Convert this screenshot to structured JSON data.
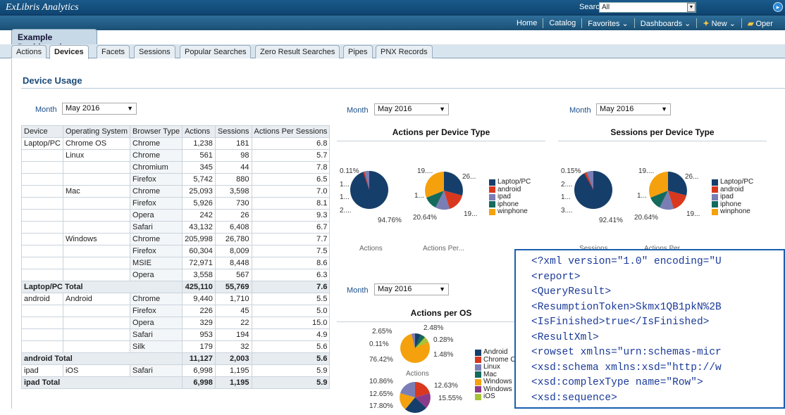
{
  "app": {
    "logo": "ExLibris Analytics",
    "search_label": "Search",
    "search_value": "All",
    "go": "▸"
  },
  "nav": {
    "dashboard_tab": "Example Dashboard",
    "links": [
      "Home",
      "Catalog",
      "Favorites ⌄",
      "Dashboards ⌄",
      "New ⌄",
      "Oper"
    ]
  },
  "tabs": [
    "Actions",
    "Devices",
    "Facets",
    "Sessions",
    "Popular Searches",
    "Zero Result Searches",
    "Pipes",
    "PNX Records"
  ],
  "section_title": "Device Usage",
  "month_label": "Month",
  "month_value": "May 2016",
  "table": {
    "headers": [
      "Device",
      "Operating System",
      "Browser Type",
      "Actions",
      "Sessions",
      "Actions Per Sessions"
    ],
    "rows": [
      [
        "Laptop/PC",
        "Chrome OS",
        "Chrome",
        "1,238",
        "181",
        "6.8"
      ],
      [
        "",
        "Linux",
        "Chrome",
        "561",
        "98",
        "5.7"
      ],
      [
        "",
        "",
        "Chromium",
        "345",
        "44",
        "7.8"
      ],
      [
        "",
        "",
        "Firefox",
        "5,742",
        "880",
        "6.5"
      ],
      [
        "",
        "Mac",
        "Chrome",
        "25,093",
        "3,598",
        "7.0"
      ],
      [
        "",
        "",
        "Firefox",
        "5,926",
        "730",
        "8.1"
      ],
      [
        "",
        "",
        "Opera",
        "242",
        "26",
        "9.3"
      ],
      [
        "",
        "",
        "Safari",
        "43,132",
        "6,408",
        "6.7"
      ],
      [
        "",
        "Windows",
        "Chrome",
        "205,998",
        "26,780",
        "7.7"
      ],
      [
        "",
        "",
        "Firefox",
        "60,304",
        "8,009",
        "7.5"
      ],
      [
        "",
        "",
        "MSIE",
        "72,971",
        "8,448",
        "8.6"
      ],
      [
        "",
        "",
        "Opera",
        "3,558",
        "567",
        "6.3"
      ],
      [
        "Laptop/PC Total",
        "",
        "",
        "425,110",
        "55,769",
        "7.6"
      ],
      [
        "android",
        "Android",
        "Chrome",
        "9,440",
        "1,710",
        "5.5"
      ],
      [
        "",
        "",
        "Firefox",
        "226",
        "45",
        "5.0"
      ],
      [
        "",
        "",
        "Opera",
        "329",
        "22",
        "15.0"
      ],
      [
        "",
        "",
        "Safari",
        "953",
        "194",
        "4.9"
      ],
      [
        "",
        "",
        "Silk",
        "179",
        "32",
        "5.6"
      ],
      [
        "android Total",
        "",
        "",
        "11,127",
        "2,003",
        "5.6"
      ],
      [
        "ipad",
        "iOS",
        "Safari",
        "6,998",
        "1,195",
        "5.9"
      ],
      [
        "ipad Total",
        "",
        "",
        "6,998",
        "1,195",
        "5.9"
      ]
    ]
  },
  "chart1": {
    "title": "Actions per Device Type",
    "sub1": "Actions",
    "sub2": "Actions Per...",
    "l_a": "0.11%",
    "l_b": "1...",
    "l_c": "1...",
    "l_d": "2....",
    "l_e": "94.76%",
    "r_a": "19....",
    "r_b": "26...",
    "r_c": "1...",
    "r_d": "19...",
    "r_e": "20.64%"
  },
  "chart2": {
    "title": "Sessions per Device Type",
    "sub1": "Sessions",
    "sub2": "Actions Per...",
    "l_a": "0.15%",
    "l_b": "2....",
    "l_c": "1...",
    "l_d": "3....",
    "l_e": "92.41%",
    "r_a": "19....",
    "r_b": "26...",
    "r_c": "1...",
    "r_d": "19...",
    "r_e": "20.64%"
  },
  "chart3": {
    "title": "Actions per OS",
    "sub1": "Actions",
    "p1": "2.65%",
    "p2": "2.48%",
    "p3": "0.11%",
    "p4": "0.28%",
    "p5": "1.48%",
    "p6": "76.42%",
    "q1": "10.86%",
    "q2": "12.63%",
    "q3": "12.65%",
    "q4": "15.55%",
    "q5": "17.80%"
  },
  "legend_devices": [
    {
      "label": "Laptop/PC",
      "color": "#163e6a"
    },
    {
      "label": "android",
      "color": "#d9381e"
    },
    {
      "label": "ipad",
      "color": "#7a7eb5"
    },
    {
      "label": "iphone",
      "color": "#146a5c"
    },
    {
      "label": "winphone",
      "color": "#f5a10d"
    }
  ],
  "legend_os": [
    {
      "label": "Android",
      "color": "#163e6a"
    },
    {
      "label": "Chrome O",
      "color": "#d9381e"
    },
    {
      "label": "Linux",
      "color": "#7a7eb5"
    },
    {
      "label": "Mac",
      "color": "#146a5c"
    },
    {
      "label": "Windows",
      "color": "#f5a10d"
    },
    {
      "label": "Windows",
      "color": "#8a3a8a"
    },
    {
      "label": "iOS",
      "color": "#a8c23a"
    }
  ],
  "xml_lines": [
    "<?xml version=\"1.0\" encoding=\"U",
    "<report>",
    "<QueryResult>",
    "<ResumptionToken>Skmx1QB1pkN%2B",
    "<IsFinished>true</IsFinished>",
    "<ResultXml>",
    "<rowset xmlns=\"urn:schemas-micr",
    "<xsd:schema xmlns:xsd=\"http://w",
    "<xsd:complexType name=\"Row\">",
    "<xsd:sequence>"
  ]
}
